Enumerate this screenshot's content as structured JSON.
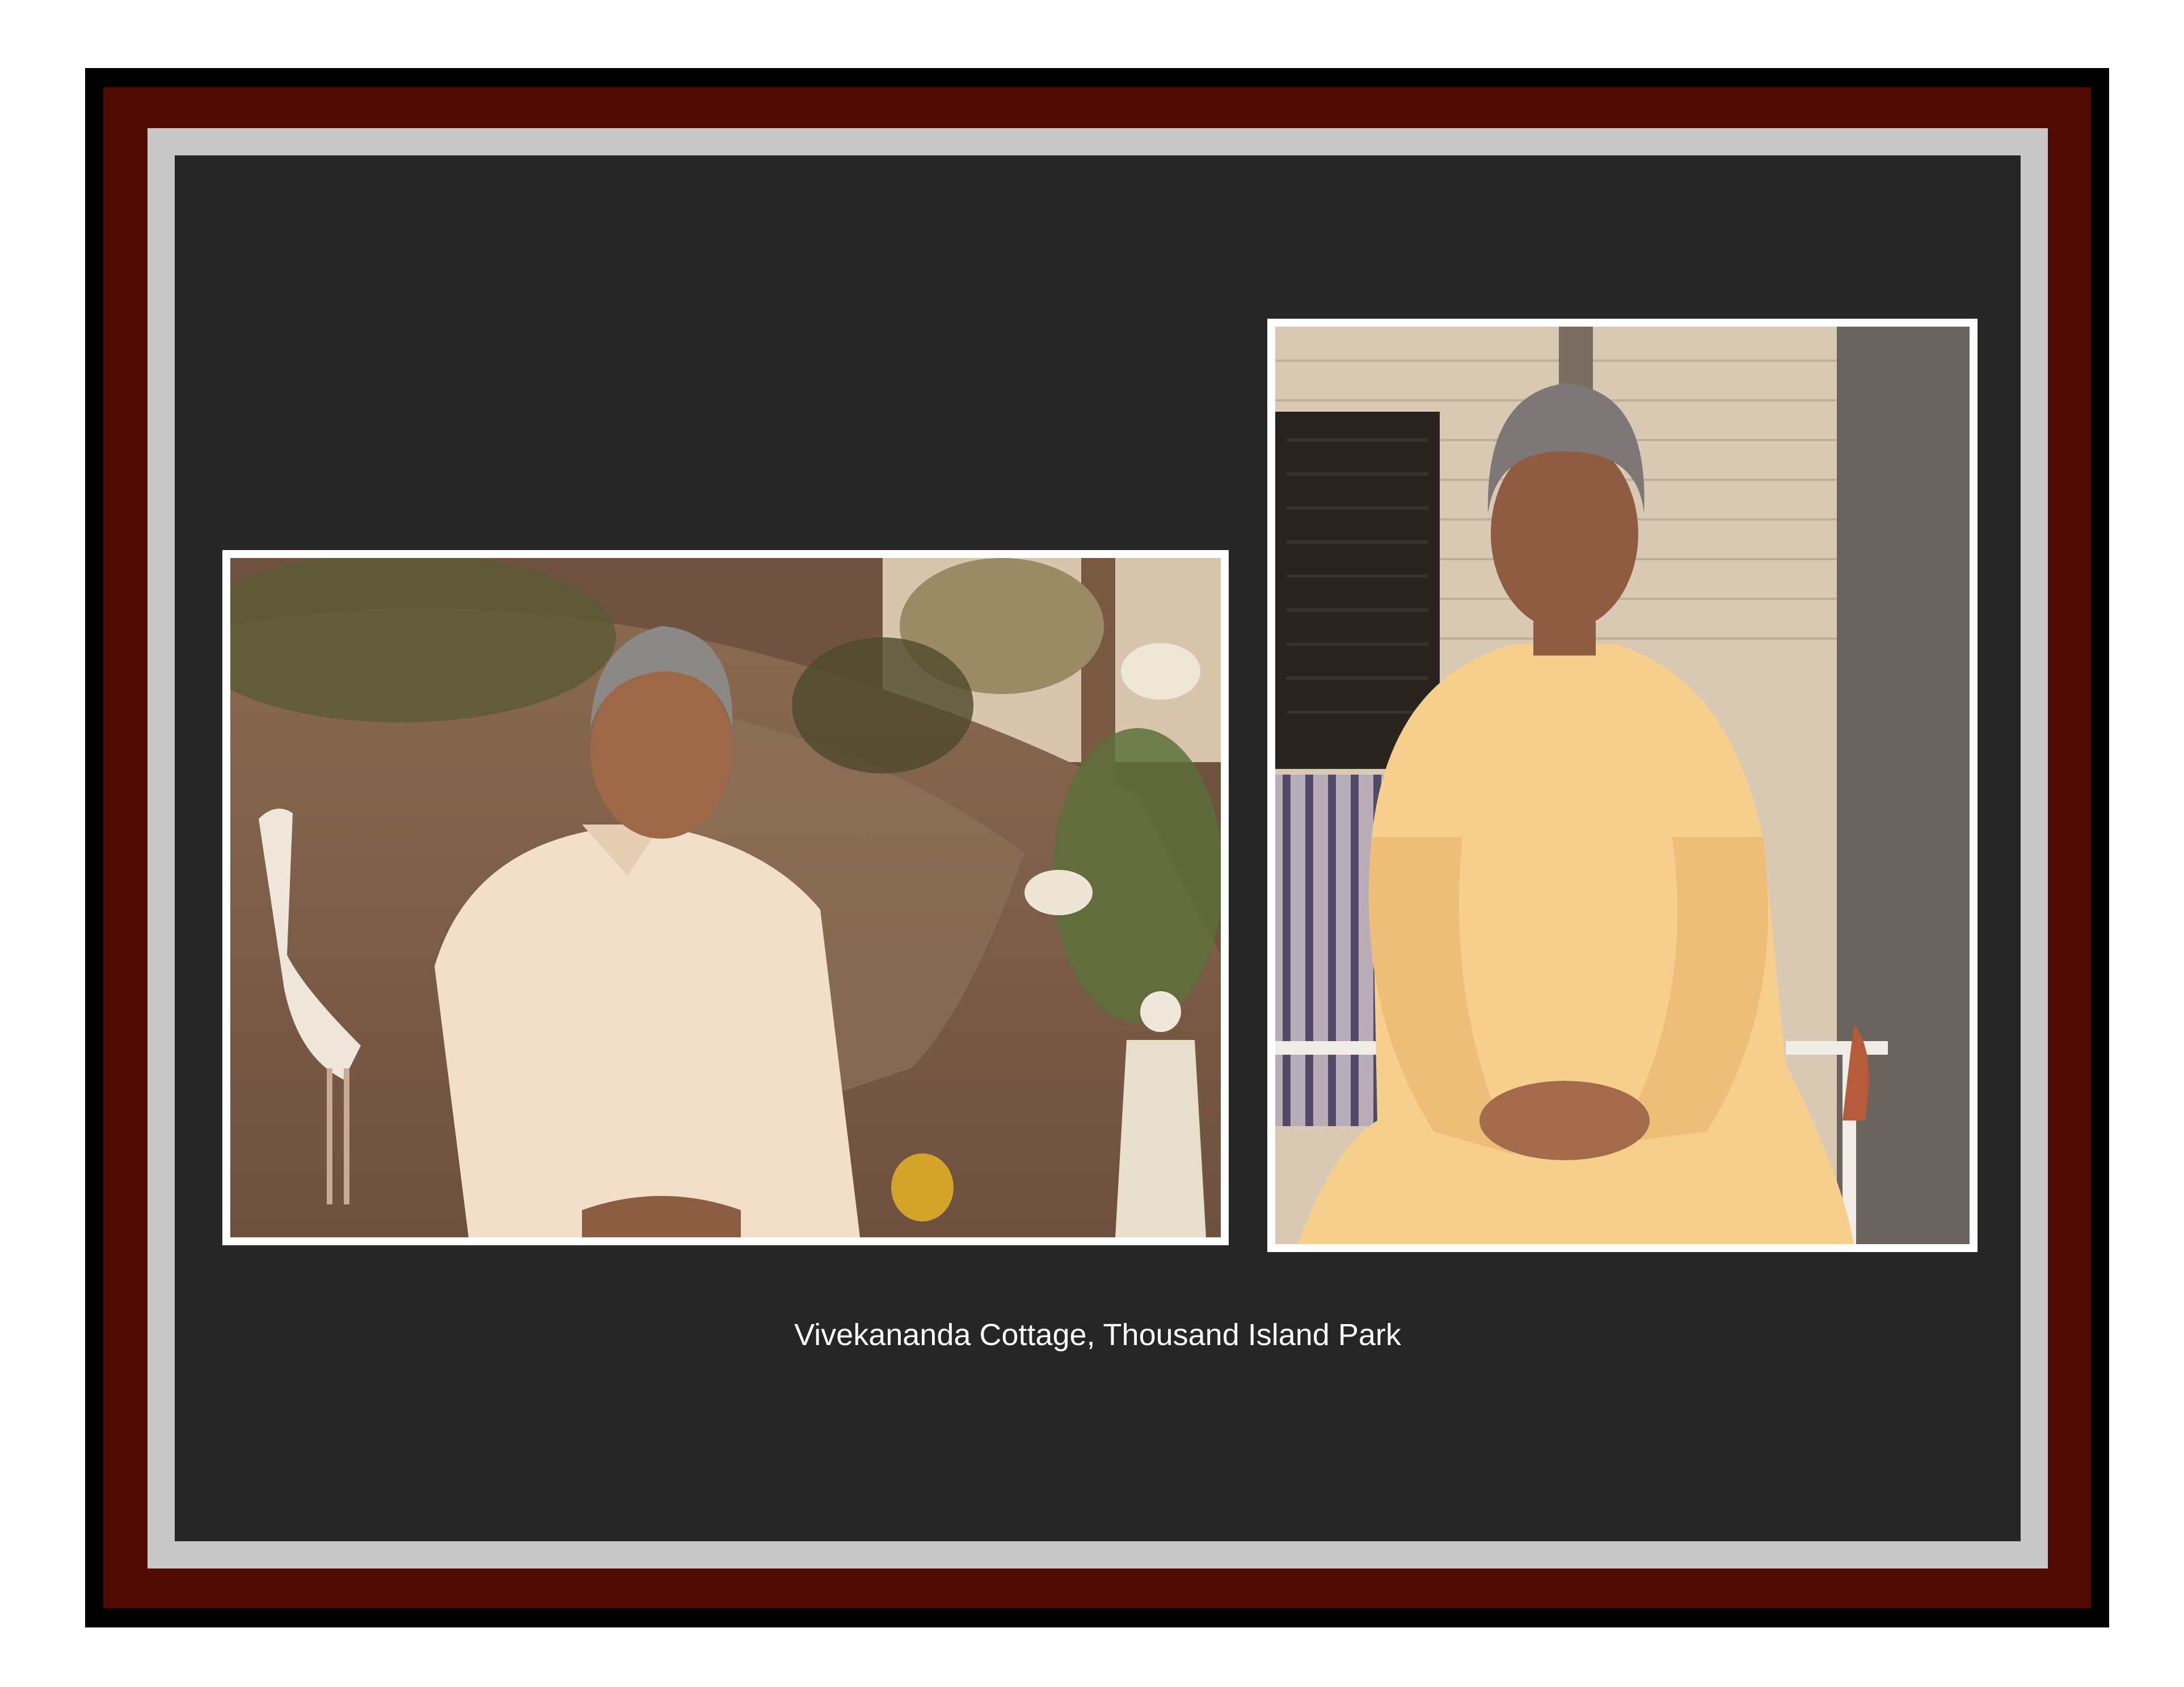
{
  "caption": "Vivekananda Cottage, Thousand Island Park",
  "colors": {
    "background": "#ffffff",
    "outer_frame": "#000000",
    "red_frame": "#500a04",
    "grey_mat": "#c8c8c8",
    "panel": "#262626",
    "caption_text": "#ffffff",
    "photo_border": "#ffffff"
  },
  "photos": [
    {
      "subject": "man in cream shirt seated in garden before rock with heron statue and small white statue"
    },
    {
      "subject": "man in saffron kurta seated on porch chair beside shuttered window"
    }
  ]
}
